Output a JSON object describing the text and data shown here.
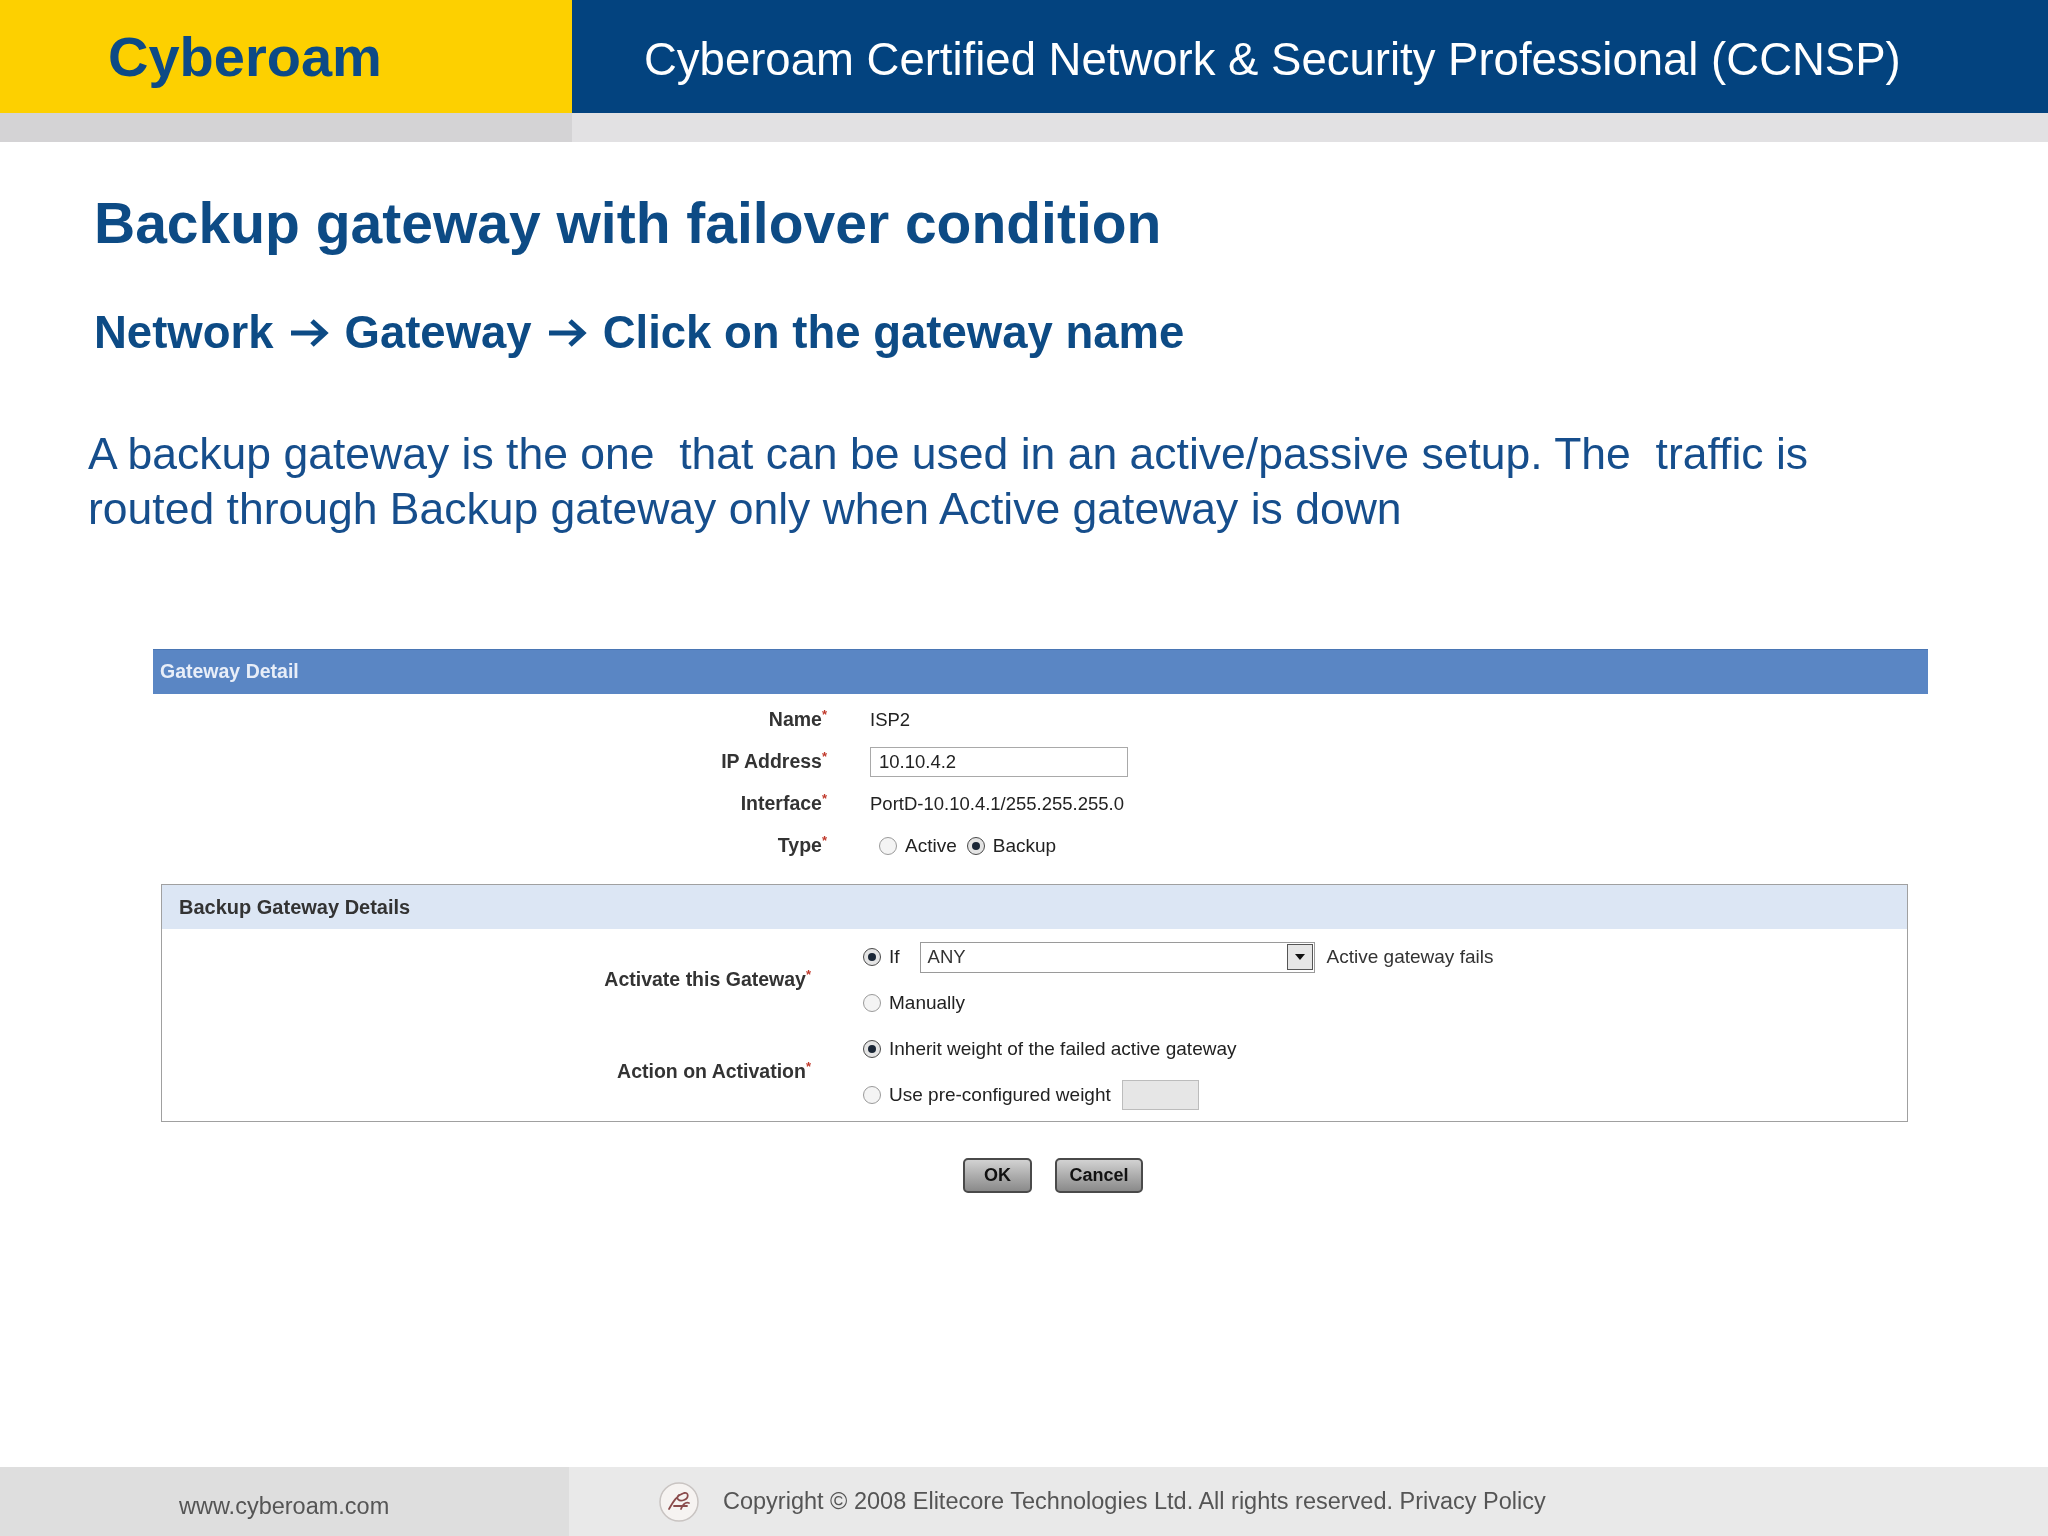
{
  "header": {
    "logo": "Cyberoam",
    "title": "Cyberoam Certified Network & Security Professional (CCNSP)"
  },
  "slide": {
    "title": "Backup gateway with failover condition",
    "steps": [
      "Network",
      "Gateway",
      "Click on the gateway name"
    ],
    "body": "A backup gateway is the one  that can be used in an active/passive setup. The  traffic is routed through Backup gateway only when Active gateway is down"
  },
  "gateway_detail": {
    "title": "Gateway Detail",
    "fields": [
      {
        "kind": "text",
        "label": "Name",
        "required_mark": "*",
        "value": "ISP2"
      },
      {
        "kind": "input",
        "label": "IP Address",
        "required_mark": "*",
        "value": "10.10.4.2"
      },
      {
        "kind": "text",
        "label": "Interface",
        "required_mark": "*",
        "value": "PortD-10.10.4.1/255.255.255.0"
      },
      {
        "kind": "radio",
        "label": "Type",
        "required_mark": "*",
        "options": [
          {
            "label": "Active",
            "selected": false
          },
          {
            "label": "Backup",
            "selected": true
          }
        ]
      }
    ]
  },
  "backup_details": {
    "title": "Backup Gateway Details",
    "groups": [
      {
        "label": "Activate this Gateway",
        "required_mark": "*",
        "options": [
          {
            "kind": "condition",
            "label": "If",
            "selected": true,
            "select_value": "ANY",
            "suffix": "Active gateway fails"
          },
          {
            "kind": "plain",
            "label": "Manually",
            "selected": false
          }
        ]
      },
      {
        "label": "Action on Activation",
        "required_mark": "*",
        "options": [
          {
            "kind": "plain",
            "label": "Inherit weight of the failed active gateway",
            "selected": true
          },
          {
            "kind": "weight",
            "label": "Use pre-configured weight",
            "selected": false,
            "disabled": true
          }
        ]
      }
    ]
  },
  "buttons": [
    "OK",
    "Cancel"
  ],
  "footer": {
    "website": "www.cyberoam.com",
    "copyright": "Copyright © 2008 Elitecore Technologies Ltd. All rights reserved. Privacy Policy"
  }
}
